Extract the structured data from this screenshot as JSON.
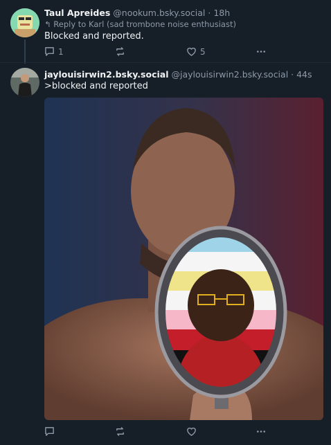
{
  "post1": {
    "author_name": "Taul Apreides",
    "author_handle": "@nookum.bsky.social",
    "time": "· 18h",
    "reply_to": "Reply to Karl (sad trombone noise enthusiast)",
    "text": "Blocked and reported.",
    "reply_count": "1",
    "repost_count": "",
    "like_count": "5"
  },
  "post2": {
    "author_name": "jaylouisirwin2.bsky.social",
    "author_handle": "@jaylouisirwin2.bsky.social",
    "time": "· 44s",
    "text": ">blocked and reported",
    "reply_count": "",
    "repost_count": "",
    "like_count": ""
  },
  "icons": {
    "reply": "reply-icon",
    "repost": "repost-icon",
    "like": "heart-icon",
    "more": "more-icon"
  },
  "colors": {
    "background": "#161e27",
    "text": "#f1f3f5",
    "muted": "#8d9aa8"
  }
}
